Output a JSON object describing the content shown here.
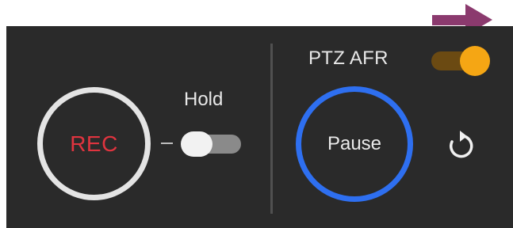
{
  "controls": {
    "rec": {
      "label": "REC",
      "color": "#e0343f"
    },
    "hold": {
      "label": "Hold",
      "state": "off"
    },
    "ptz_afr": {
      "label": "PTZ AFR",
      "state": "on",
      "accent": "#f5a614"
    },
    "pause": {
      "label": "Pause",
      "ring_color": "#2e6ff0"
    },
    "reset": {
      "icon": "rotate-right-icon"
    }
  },
  "annotation": {
    "icon": "arrow-right-icon",
    "color": "#8b3a6e"
  },
  "colors": {
    "panel_background": "#2a2a2a",
    "divider": "#505050",
    "text": "#e8e8e8"
  }
}
